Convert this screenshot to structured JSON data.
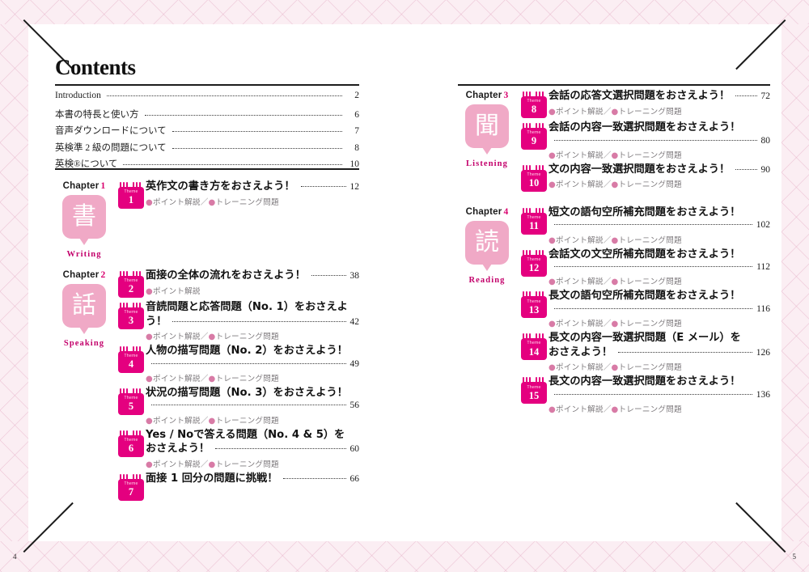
{
  "meta": {
    "title": "Contents",
    "folio_left": "4",
    "folio_right": "5",
    "accent_deep": "#e4007f",
    "accent_light": "#f0a9c6",
    "accent_text": "#c3006b"
  },
  "front_matter": [
    {
      "label": "Introduction",
      "page": "2"
    },
    {
      "label": "本書の特長と使い方",
      "page": "6"
    },
    {
      "label": "音声ダウンロードについて",
      "page": "7"
    },
    {
      "label": "英検準 2 級の問題について",
      "page": "8"
    },
    {
      "label": "英検®について",
      "page": "10"
    }
  ],
  "sub_both": "●ポイント解説／●トレーニング問題",
  "sub_point_only": "●ポイント解説",
  "theme_word": "Theme",
  "chapters": [
    {
      "label": "Chapter",
      "number": "1",
      "kanji": "書",
      "english": "Writing",
      "themes": [
        {
          "no": "1",
          "title": "英作文の書き方をおさえよう！",
          "page": "12",
          "wrap": false,
          "sub": "●ポイント解説／●トレーニング問題"
        }
      ]
    },
    {
      "label": "Chapter",
      "number": "2",
      "kanji": "話",
      "english": "Speaking",
      "themes": [
        {
          "no": "2",
          "title": "面接の全体の流れをおさえよう！",
          "page": "38",
          "wrap": false,
          "sub": "●ポイント解説"
        },
        {
          "no": "3",
          "title": "音読問題と応答問題（No. 1）をおさえよ",
          "title2": "う！",
          "page": "42",
          "wrap": true,
          "sub": "●ポイント解説／●トレーニング問題"
        },
        {
          "no": "4",
          "title": "人物の描写問題（No. 2）をおさえよう！",
          "title2": "",
          "page": "49",
          "wrap": true,
          "sub": "●ポイント解説／●トレーニング問題"
        },
        {
          "no": "5",
          "title": "状況の描写問題（No. 3）をおさえよう！",
          "title2": "",
          "page": "56",
          "wrap": true,
          "sub": "●ポイント解説／●トレーニング問題"
        },
        {
          "no": "6",
          "title": "Yes / Noで答える問題（No. 4 & 5）を",
          "title2": "おさえよう！",
          "page": "60",
          "wrap": true,
          "sub": "●ポイント解説／●トレーニング問題"
        },
        {
          "no": "7",
          "title": "面接 1 回分の問題に挑戦！",
          "page": "66",
          "wrap": false,
          "sub": ""
        }
      ]
    },
    {
      "label": "Chapter",
      "number": "3",
      "kanji": "聞",
      "english": "Listening",
      "themes": [
        {
          "no": "8",
          "title": "会話の応答文選択問題をおさえよう！",
          "page": "72",
          "wrap": false,
          "sub": "●ポイント解説／●トレーニング問題"
        },
        {
          "no": "9",
          "title": "会話の内容一致選択問題をおさえよう！",
          "title2": "",
          "page": "80",
          "wrap": true,
          "sub": "●ポイント解説／●トレーニング問題"
        },
        {
          "no": "10",
          "title": "文の内容一致選択問題をおさえよう！",
          "page": "90",
          "wrap": false,
          "sub": "●ポイント解説／●トレーニング問題"
        }
      ]
    },
    {
      "label": "Chapter",
      "number": "4",
      "kanji": "読",
      "english": "Reading",
      "themes": [
        {
          "no": "11",
          "title": "短文の語句空所補充問題をおさえよう！",
          "title2": "",
          "page": "102",
          "wrap": true,
          "sub": "●ポイント解説／●トレーニング問題"
        },
        {
          "no": "12",
          "title": "会話文の文空所補充問題をおさえよう！",
          "title2": "",
          "page": "112",
          "wrap": true,
          "sub": "●ポイント解説／●トレーニング問題"
        },
        {
          "no": "13",
          "title": "長文の語句空所補充問題をおさえよう！",
          "title2": "",
          "page": "116",
          "wrap": true,
          "sub": "●ポイント解説／●トレーニング問題"
        },
        {
          "no": "14",
          "title": "長文の内容一致選択問題（E メール）を",
          "title2": "おさえよう！",
          "page": "126",
          "wrap": true,
          "sub": "●ポイント解説／●トレーニング問題"
        },
        {
          "no": "15",
          "title": "長文の内容一致選択問題をおさえよう！",
          "title2": "",
          "page": "136",
          "wrap": true,
          "sub": "●ポイント解説／●トレーニング問題"
        }
      ]
    }
  ]
}
